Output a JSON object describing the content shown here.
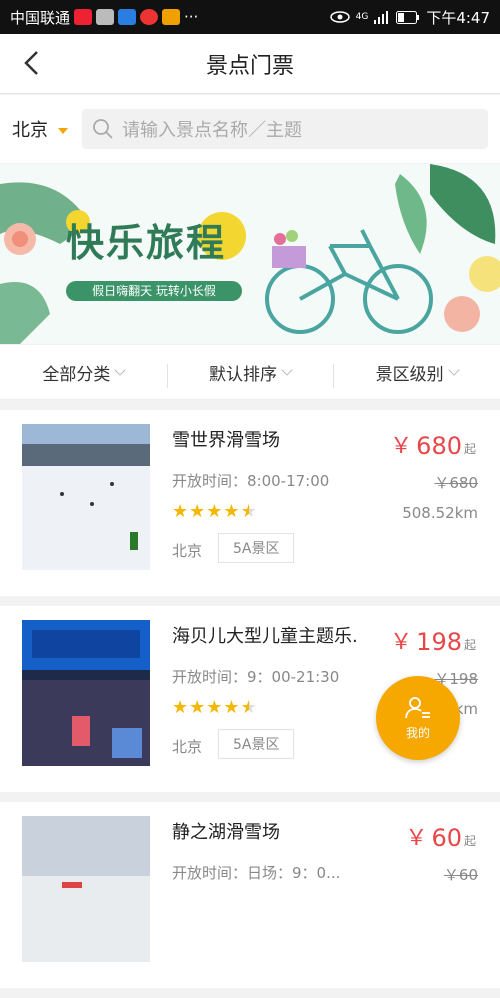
{
  "status_bar": {
    "carrier": "中国联通",
    "dots": "···",
    "net": "4G",
    "time": "下午4:47"
  },
  "header": {
    "title": "景点门票"
  },
  "search": {
    "city": "北京",
    "placeholder": "请输入景点名称／主题"
  },
  "banner": {
    "headline": "快乐旅程",
    "tagline": "假日嗨翻天 玩转小长假"
  },
  "filters": [
    {
      "label": "全部分类"
    },
    {
      "label": "默认排序"
    },
    {
      "label": "景区级别"
    }
  ],
  "items": [
    {
      "name": "雪世界滑雪场",
      "open": "开放时间：8:00-17:00",
      "price": "680",
      "currency": "￥",
      "suffix": "起",
      "orig": "￥680",
      "distance": "508.52km",
      "city": "北京",
      "level": "5A景区",
      "rating": 4.5
    },
    {
      "name": "海贝儿大型儿童主题乐.",
      "open": "开放时间：9：00-21:30",
      "price": "198",
      "currency": "￥",
      "suffix": "起",
      "orig": "￥198",
      "distance": "508.52km",
      "city": "北京",
      "level": "5A景区",
      "rating": 4.5
    },
    {
      "name": "静之湖滑雪场",
      "open": "开放时间：日场：9：0...",
      "price": "60",
      "currency": "￥",
      "suffix": "起",
      "orig": "￥60",
      "distance": "",
      "city": "",
      "level": "",
      "rating": 0
    }
  ],
  "fab": {
    "label": "我的"
  },
  "colors": {
    "accent": "#f6a800",
    "price": "#e8474a"
  }
}
